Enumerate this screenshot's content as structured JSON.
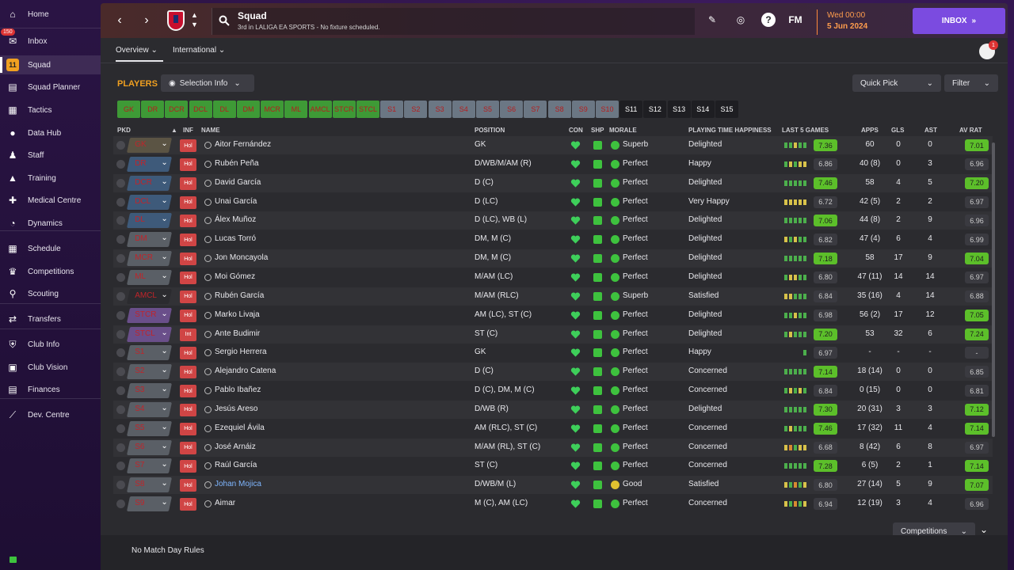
{
  "sidebar": {
    "items": [
      {
        "label": "Home",
        "icon": "home-icon",
        "glyph": "⌂"
      },
      {
        "label": "Inbox",
        "icon": "inbox-icon",
        "glyph": "✉",
        "badge": "150"
      },
      {
        "label": "Squad",
        "icon": "squad-icon",
        "glyph": "11"
      },
      {
        "label": "Squad Planner",
        "icon": "squad-planner-icon",
        "glyph": "▤"
      },
      {
        "label": "Tactics",
        "icon": "tactics-icon",
        "glyph": "▦"
      },
      {
        "label": "Data Hub",
        "icon": "data-hub-icon",
        "glyph": "●"
      },
      {
        "label": "Staff",
        "icon": "staff-icon",
        "glyph": "♟"
      },
      {
        "label": "Training",
        "icon": "training-icon",
        "glyph": "▲"
      },
      {
        "label": "Medical Centre",
        "icon": "medical-icon",
        "glyph": "✚"
      },
      {
        "label": "Dynamics",
        "icon": "dynamics-icon",
        "glyph": "◔"
      },
      {
        "label": "Schedule",
        "icon": "schedule-icon",
        "glyph": "▦"
      },
      {
        "label": "Competitions",
        "icon": "trophy-icon",
        "glyph": "♛"
      },
      {
        "label": "Scouting",
        "icon": "scouting-icon",
        "glyph": "⚲"
      },
      {
        "label": "Transfers",
        "icon": "transfers-icon",
        "glyph": "⇄"
      },
      {
        "label": "Club Info",
        "icon": "club-info-icon",
        "glyph": "⛨"
      },
      {
        "label": "Club Vision",
        "icon": "club-vision-icon",
        "glyph": "▣"
      },
      {
        "label": "Finances",
        "icon": "finances-icon",
        "glyph": "▤"
      },
      {
        "label": "Dev. Centre",
        "icon": "dev-centre-icon",
        "glyph": "⟋"
      }
    ]
  },
  "header": {
    "title": "Squad",
    "subtitle": "3rd in LALIGA EA SPORTS - No fixture scheduled.",
    "date_line1": "Wed 00:00",
    "date_line2": "5 Jun 2024",
    "inbox_label": "INBOX",
    "fm_label": "FM",
    "help_label": "?",
    "notification_count": "1"
  },
  "tabs": {
    "overview": "Overview",
    "international": "International"
  },
  "players_section": {
    "label": "PLAYERS",
    "selection_info": "Selection Info",
    "quick_pick": "Quick Pick",
    "filter": "Filter",
    "competitions": "Competitions",
    "footer": "No Match Day Rules"
  },
  "position_chips": [
    {
      "label": "GK",
      "style": "green"
    },
    {
      "label": "DR",
      "style": "green"
    },
    {
      "label": "DCR",
      "style": "green"
    },
    {
      "label": "DCL",
      "style": "green"
    },
    {
      "label": "DL",
      "style": "green"
    },
    {
      "label": "DM",
      "style": "green"
    },
    {
      "label": "MCR",
      "style": "green"
    },
    {
      "label": "ML",
      "style": "green"
    },
    {
      "label": "AMCL",
      "style": "green"
    },
    {
      "label": "STCR",
      "style": "green"
    },
    {
      "label": "STCL",
      "style": "green"
    },
    {
      "label": "S1",
      "style": "grey"
    },
    {
      "label": "S2",
      "style": "grey"
    },
    {
      "label": "S3",
      "style": "grey"
    },
    {
      "label": "S4",
      "style": "grey"
    },
    {
      "label": "S5",
      "style": "grey"
    },
    {
      "label": "S6",
      "style": "grey"
    },
    {
      "label": "S7",
      "style": "grey"
    },
    {
      "label": "S8",
      "style": "grey"
    },
    {
      "label": "S9",
      "style": "grey"
    },
    {
      "label": "S10",
      "style": "grey"
    },
    {
      "label": "S11",
      "style": "plain"
    },
    {
      "label": "S12",
      "style": "plain"
    },
    {
      "label": "S13",
      "style": "plain"
    },
    {
      "label": "S14",
      "style": "plain"
    },
    {
      "label": "S15",
      "style": "plain"
    }
  ],
  "columns": {
    "pkd": "PKD",
    "inf": "INF",
    "name": "NAME",
    "position": "POSITION",
    "con": "CON",
    "shp": "SHP",
    "morale": "MORALE",
    "pth": "PLAYING TIME HAPPINESS",
    "last5": "LAST 5 GAMES",
    "apps": "APPS",
    "gls": "GLS",
    "ast": "AST",
    "avrat": "AV RAT"
  },
  "colors": {
    "accent": "#7b4be0",
    "rating_green": "#5cbf2a",
    "players_label": "#f0a020",
    "position_red": "#c0242a"
  },
  "players": [
    {
      "pkd": "GK",
      "sel": "#5b5444",
      "inf": "Hol",
      "name": "Aitor Fernández",
      "position": "GK",
      "morale": "Superb",
      "morale_type": "superb",
      "pth": "Delighted",
      "bars": [
        "g",
        "g",
        "y",
        "g",
        "g"
      ],
      "last5": "7.36",
      "last5_green": true,
      "apps": "60",
      "gls": "0",
      "ast": "0",
      "avrat": "7.01",
      "avrat_green": true
    },
    {
      "pkd": "DR",
      "sel": "#3e5a7a",
      "inf": "Hol",
      "name": "Rubén Peña",
      "position": "D/WB/M/AM (R)",
      "morale": "Perfect",
      "morale_type": "perfect",
      "pth": "Happy",
      "bars": [
        "g",
        "y",
        "g",
        "y",
        "y"
      ],
      "last5": "6.86",
      "last5_green": false,
      "apps": "40 (8)",
      "gls": "0",
      "ast": "3",
      "avrat": "6.96",
      "avrat_green": false
    },
    {
      "pkd": "DCR",
      "sel": "#3e5a7a",
      "inf": "Hol",
      "name": "David García",
      "position": "D (C)",
      "morale": "Perfect",
      "morale_type": "perfect",
      "pth": "Delighted",
      "bars": [
        "g",
        "g",
        "g",
        "g",
        "g"
      ],
      "last5": "7.46",
      "last5_green": true,
      "apps": "58",
      "gls": "4",
      "ast": "5",
      "avrat": "7.20",
      "avrat_green": true
    },
    {
      "pkd": "DCL",
      "sel": "#3e5a7a",
      "inf": "Hol",
      "name": "Unai García",
      "position": "D (LC)",
      "morale": "Perfect",
      "morale_type": "perfect",
      "pth": "Very Happy",
      "bars": [
        "y",
        "y",
        "y",
        "y",
        "y"
      ],
      "last5": "6.72",
      "last5_green": false,
      "apps": "42 (5)",
      "gls": "2",
      "ast": "2",
      "avrat": "6.97",
      "avrat_green": false
    },
    {
      "pkd": "DL",
      "sel": "#3e5a7a",
      "inf": "Hol",
      "name": "Álex Muñoz",
      "position": "D (LC), WB (L)",
      "morale": "Perfect",
      "morale_type": "perfect",
      "pth": "Delighted",
      "bars": [
        "g",
        "g",
        "g",
        "g",
        "g"
      ],
      "last5": "7.06",
      "last5_green": true,
      "apps": "44 (8)",
      "gls": "2",
      "ast": "9",
      "avrat": "6.96",
      "avrat_green": false
    },
    {
      "pkd": "DM",
      "sel": "#5a5f66",
      "inf": "Hol",
      "name": "Lucas Torró",
      "position": "DM, M (C)",
      "morale": "Perfect",
      "morale_type": "perfect",
      "pth": "Delighted",
      "bars": [
        "y",
        "g",
        "y",
        "g",
        "g"
      ],
      "last5": "6.82",
      "last5_green": false,
      "apps": "47 (4)",
      "gls": "6",
      "ast": "4",
      "avrat": "6.99",
      "avrat_green": false
    },
    {
      "pkd": "MCR",
      "sel": "#5a5f66",
      "inf": "Hol",
      "name": "Jon Moncayola",
      "position": "DM, M (C)",
      "morale": "Perfect",
      "morale_type": "perfect",
      "pth": "Delighted",
      "bars": [
        "g",
        "g",
        "g",
        "g",
        "g"
      ],
      "last5": "7.18",
      "last5_green": true,
      "apps": "58",
      "gls": "17",
      "ast": "9",
      "avrat": "7.04",
      "avrat_green": true
    },
    {
      "pkd": "ML",
      "sel": "#5a5f66",
      "inf": "Hol",
      "name": "Moi Gómez",
      "position": "M/AM (LC)",
      "morale": "Perfect",
      "morale_type": "perfect",
      "pth": "Delighted",
      "bars": [
        "g",
        "y",
        "y",
        "g",
        "g"
      ],
      "last5": "6.80",
      "last5_green": false,
      "apps": "47 (11)",
      "gls": "14",
      "ast": "14",
      "avrat": "6.97",
      "avrat_green": false
    },
    {
      "pkd": "AMCL",
      "sel": "#2b2b2f",
      "inf": "Hol",
      "name": "Rubén García",
      "position": "M/AM (RLC)",
      "morale": "Superb",
      "morale_type": "superb",
      "pth": "Satisfied",
      "bars": [
        "y",
        "y",
        "g",
        "g",
        "g"
      ],
      "last5": "6.84",
      "last5_green": false,
      "apps": "35 (16)",
      "gls": "4",
      "ast": "14",
      "avrat": "6.88",
      "avrat_green": false
    },
    {
      "pkd": "STCR",
      "sel": "#6a4f8a",
      "inf": "Hol",
      "name": "Marko Livaja",
      "position": "AM (LC), ST (C)",
      "morale": "Perfect",
      "morale_type": "perfect",
      "pth": "Delighted",
      "bars": [
        "g",
        "g",
        "y",
        "g",
        "g"
      ],
      "last5": "6.98",
      "last5_green": false,
      "apps": "56 (2)",
      "gls": "17",
      "ast": "12",
      "avrat": "7.05",
      "avrat_green": true
    },
    {
      "pkd": "STCL",
      "sel": "#6a4f8a",
      "inf": "Int",
      "name": "Ante Budimir",
      "position": "ST (C)",
      "morale": "Perfect",
      "morale_type": "perfect",
      "pth": "Delighted",
      "bars": [
        "g",
        "y",
        "g",
        "g",
        "g"
      ],
      "last5": "7.20",
      "last5_green": true,
      "apps": "53",
      "gls": "32",
      "ast": "6",
      "avrat": "7.24",
      "avrat_green": true
    },
    {
      "pkd": "S1",
      "sel": "#5a5f66",
      "inf": "Hol",
      "name": "Sergio Herrera",
      "position": "GK",
      "morale": "Perfect",
      "morale_type": "perfect",
      "pth": "Happy",
      "bars": [
        "g"
      ],
      "last5": "6.97",
      "last5_green": false,
      "apps": "-",
      "gls": "-",
      "ast": "-",
      "avrat": "-",
      "avrat_green": false
    },
    {
      "pkd": "S2",
      "sel": "#5a5f66",
      "inf": "Hol",
      "name": "Alejandro Catena",
      "position": "D (C)",
      "morale": "Perfect",
      "morale_type": "perfect",
      "pth": "Concerned",
      "bars": [
        "g",
        "g",
        "g",
        "g",
        "g"
      ],
      "last5": "7.14",
      "last5_green": true,
      "apps": "18 (14)",
      "gls": "0",
      "ast": "0",
      "avrat": "6.85",
      "avrat_green": false
    },
    {
      "pkd": "S3",
      "sel": "#5a5f66",
      "inf": "Hol",
      "name": "Pablo Ibañez",
      "position": "D (C), DM, M (C)",
      "morale": "Perfect",
      "morale_type": "perfect",
      "pth": "Concerned",
      "bars": [
        "g",
        "y",
        "g",
        "y",
        "g"
      ],
      "last5": "6.84",
      "last5_green": false,
      "apps": "0 (15)",
      "gls": "0",
      "ast": "0",
      "avrat": "6.81",
      "avrat_green": false
    },
    {
      "pkd": "S4",
      "sel": "#5a5f66",
      "inf": "Hol",
      "name": "Jesús Areso",
      "position": "D/WB (R)",
      "morale": "Perfect",
      "morale_type": "perfect",
      "pth": "Delighted",
      "bars": [
        "g",
        "g",
        "g",
        "g",
        "g"
      ],
      "last5": "7.30",
      "last5_green": true,
      "apps": "20 (31)",
      "gls": "3",
      "ast": "3",
      "avrat": "7.12",
      "avrat_green": true
    },
    {
      "pkd": "S5",
      "sel": "#5a5f66",
      "inf": "Hol",
      "name": "Ezequiel Ávila",
      "position": "AM (RLC), ST (C)",
      "morale": "Perfect",
      "morale_type": "perfect",
      "pth": "Concerned",
      "bars": [
        "g",
        "y",
        "g",
        "g",
        "g"
      ],
      "last5": "7.46",
      "last5_green": true,
      "apps": "17 (32)",
      "gls": "11",
      "ast": "4",
      "avrat": "7.14",
      "avrat_green": true
    },
    {
      "pkd": "S6",
      "sel": "#5a5f66",
      "inf": "Hol",
      "name": "José Arnáiz",
      "position": "M/AM (RL), ST (C)",
      "morale": "Perfect",
      "morale_type": "perfect",
      "pth": "Concerned",
      "bars": [
        "y",
        "o",
        "g",
        "y",
        "y"
      ],
      "last5": "6.68",
      "last5_green": false,
      "apps": "8 (42)",
      "gls": "6",
      "ast": "8",
      "avrat": "6.97",
      "avrat_green": false
    },
    {
      "pkd": "S7",
      "sel": "#5a5f66",
      "inf": "Hol",
      "name": "Raúl García",
      "position": "ST (C)",
      "morale": "Perfect",
      "morale_type": "perfect",
      "pth": "Concerned",
      "bars": [
        "g",
        "g",
        "g",
        "g",
        "g"
      ],
      "last5": "7.28",
      "last5_green": true,
      "apps": "6 (5)",
      "gls": "2",
      "ast": "1",
      "avrat": "7.14",
      "avrat_green": true
    },
    {
      "pkd": "S8",
      "sel": "#5a5f66",
      "inf": "Hol",
      "name": "Johan Mojica",
      "position": "D/WB/M (L)",
      "morale": "Good",
      "morale_type": "good",
      "pth": "Satisfied",
      "bars": [
        "y",
        "g",
        "o",
        "g",
        "y"
      ],
      "last5": "6.80",
      "last5_green": false,
      "apps": "27 (14)",
      "gls": "5",
      "ast": "9",
      "avrat": "7.07",
      "avrat_green": true,
      "name_link": true
    },
    {
      "pkd": "S9",
      "sel": "#5a5f66",
      "inf": "Hol",
      "name": "Aimar",
      "position": "M (C), AM (LC)",
      "morale": "Perfect",
      "morale_type": "perfect",
      "pth": "Concerned",
      "bars": [
        "y",
        "g",
        "o",
        "g",
        "y"
      ],
      "last5": "6.94",
      "last5_green": false,
      "apps": "12 (19)",
      "gls": "3",
      "ast": "4",
      "avrat": "6.96",
      "avrat_green": false
    }
  ]
}
